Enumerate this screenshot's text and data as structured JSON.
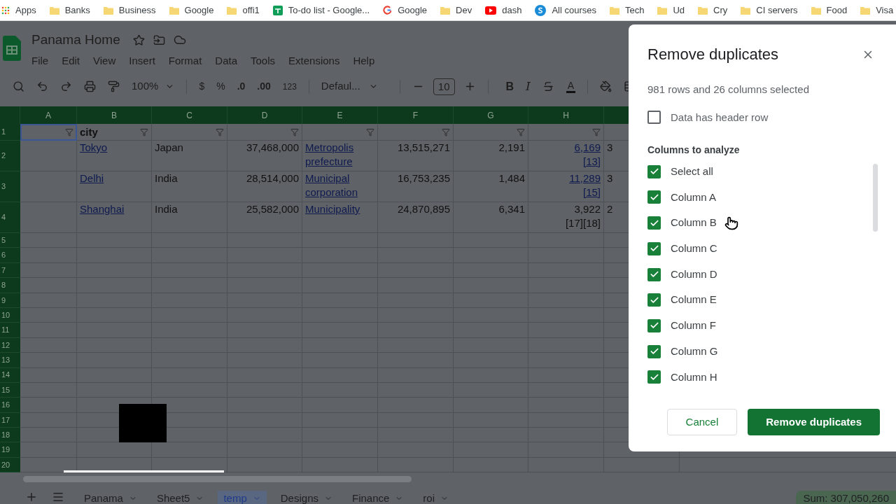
{
  "bookmarks": [
    {
      "label": "Apps",
      "kind": "apps"
    },
    {
      "label": "Banks",
      "kind": "folder"
    },
    {
      "label": "Business",
      "kind": "folder"
    },
    {
      "label": "Google",
      "kind": "folder"
    },
    {
      "label": "offi1",
      "kind": "folder"
    },
    {
      "label": "To-do list - Google...",
      "kind": "sheets"
    },
    {
      "label": "Google",
      "kind": "google"
    },
    {
      "label": "Dev",
      "kind": "folder"
    },
    {
      "label": "dash",
      "kind": "youtube"
    },
    {
      "label": "All courses",
      "kind": "skype"
    },
    {
      "label": "Tech",
      "kind": "folder"
    },
    {
      "label": "Ud",
      "kind": "folder"
    },
    {
      "label": "Cry",
      "kind": "folder"
    },
    {
      "label": "CI servers",
      "kind": "folder"
    },
    {
      "label": "Food",
      "kind": "folder"
    },
    {
      "label": "Visa",
      "kind": "folder"
    }
  ],
  "document": {
    "title": "Panama Home",
    "menu": [
      "File",
      "Edit",
      "View",
      "Insert",
      "Format",
      "Data",
      "Tools",
      "Extensions",
      "Help"
    ]
  },
  "toolbar": {
    "zoom": "100%",
    "currency": "$",
    "percent": "%",
    "decrease_decimals": ".0",
    "increase_decimals": ".00",
    "number_format": "123",
    "font": "Defaul...",
    "font_size": "10",
    "bold": "B",
    "italic": "I",
    "text_color": "A"
  },
  "grid": {
    "columns": [
      "A",
      "B",
      "C",
      "D",
      "E",
      "F",
      "G",
      "H"
    ],
    "rows": [
      {
        "number": "1",
        "header": true,
        "cells": [
          {
            "selected": true
          },
          {
            "text": [
              "city"
            ],
            "kind": "text"
          },
          {},
          {},
          {},
          {},
          {},
          {},
          null
        ]
      },
      {
        "number": "2",
        "cells": [
          null,
          {
            "text": [
              "Tokyo"
            ],
            "kind": "link"
          },
          {
            "text": [
              "Japan"
            ],
            "kind": "text"
          },
          {
            "text": [
              "37,468,000"
            ],
            "kind": "number"
          },
          {
            "text": [
              "Metropolis",
              "prefecture"
            ],
            "kind": "link"
          },
          {
            "text": [
              "13,515,271"
            ],
            "kind": "number"
          },
          {
            "text": [
              "2,191"
            ],
            "kind": "number"
          },
          {
            "text": [
              "6,169",
              "[13]"
            ],
            "kind": "number_link"
          },
          {
            "text": [
              "3"
            ],
            "kind": "text"
          }
        ]
      },
      {
        "number": "3",
        "cells": [
          null,
          {
            "text": [
              "Delhi"
            ],
            "kind": "link"
          },
          {
            "text": [
              "India"
            ],
            "kind": "text"
          },
          {
            "text": [
              "28,514,000"
            ],
            "kind": "number"
          },
          {
            "text": [
              "Municipal",
              "corporation"
            ],
            "kind": "link"
          },
          {
            "text": [
              "16,753,235"
            ],
            "kind": "number"
          },
          {
            "text": [
              "1,484"
            ],
            "kind": "number"
          },
          {
            "text": [
              "11,289",
              "[15]"
            ],
            "kind": "number_link"
          },
          {
            "text": [
              "3"
            ],
            "kind": "text"
          }
        ]
      },
      {
        "number": "4",
        "cells": [
          null,
          {
            "text": [
              "Shanghai"
            ],
            "kind": "link"
          },
          {
            "text": [
              "India"
            ],
            "kind": "text"
          },
          {
            "text": [
              "25,582,000"
            ],
            "kind": "number"
          },
          {
            "text": [
              "Municipality"
            ],
            "kind": "link"
          },
          {
            "text": [
              "24,870,895"
            ],
            "kind": "number"
          },
          {
            "text": [
              "6,341"
            ],
            "kind": "number"
          },
          {
            "text": [
              "3,922",
              "[17][18]"
            ],
            "kind": "number"
          },
          {
            "text": [
              "2"
            ],
            "kind": "text"
          }
        ]
      },
      {
        "number": "5"
      },
      {
        "number": "6"
      },
      {
        "number": "7"
      },
      {
        "number": "8"
      },
      {
        "number": "9"
      },
      {
        "number": "10"
      },
      {
        "number": "11"
      },
      {
        "number": "12"
      },
      {
        "number": "13"
      },
      {
        "number": "14"
      },
      {
        "number": "15"
      },
      {
        "number": "16"
      },
      {
        "number": "17"
      },
      {
        "number": "18"
      },
      {
        "number": "19"
      },
      {
        "number": "20"
      }
    ]
  },
  "sheet_tabs": [
    {
      "label": "Panama",
      "selected": false
    },
    {
      "label": "Sheet5",
      "selected": false
    },
    {
      "label": "temp",
      "selected": true
    },
    {
      "label": "Designs",
      "selected": false
    },
    {
      "label": "Finance",
      "selected": false
    },
    {
      "label": "roi",
      "selected": false
    }
  ],
  "sum": "Sum: 307,050,260",
  "dialog": {
    "title": "Remove duplicates",
    "summary": "981 rows and 26 columns selected",
    "header_row": {
      "label": "Data has header row",
      "checked": false
    },
    "section": "Columns to analyze",
    "columns": [
      {
        "label": "Select all",
        "checked": true
      },
      {
        "label": "Column A",
        "checked": true
      },
      {
        "label": "Column B",
        "checked": true
      },
      {
        "label": "Column C",
        "checked": true
      },
      {
        "label": "Column D",
        "checked": true
      },
      {
        "label": "Column E",
        "checked": true
      },
      {
        "label": "Column F",
        "checked": true
      },
      {
        "label": "Column G",
        "checked": true
      },
      {
        "label": "Column H",
        "checked": true
      }
    ],
    "cancel": "Cancel",
    "confirm": "Remove duplicates"
  }
}
